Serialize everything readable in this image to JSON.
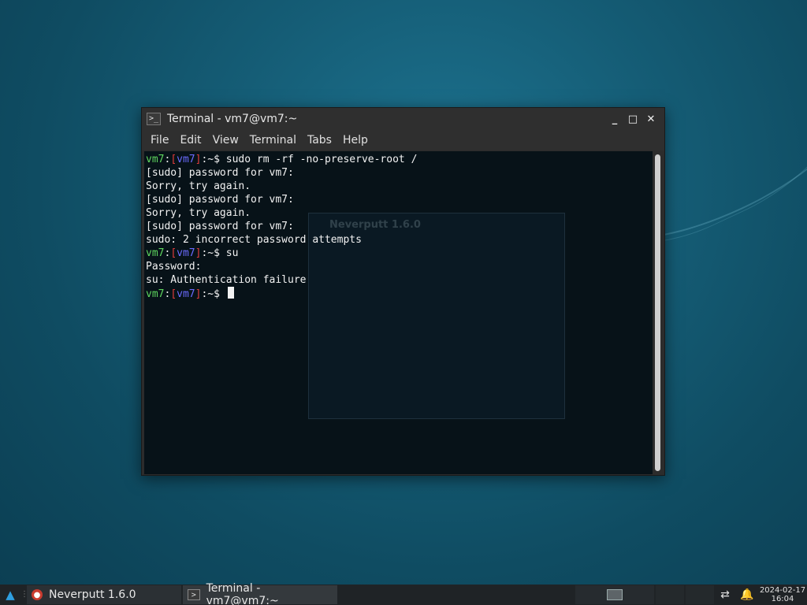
{
  "window": {
    "title": "Terminal - vm7@vm7:~",
    "icon": "terminal-icon",
    "controls": {
      "minimize": "_",
      "maximize": "□",
      "close": "✕"
    },
    "menu": [
      "File",
      "Edit",
      "View",
      "Terminal",
      "Tabs",
      "Help"
    ]
  },
  "terminal": {
    "prompt": {
      "user": "vm7",
      "host": "vm7",
      "path": "~",
      "symbol": "$"
    },
    "lines": [
      {
        "type": "prompt",
        "cmd": "sudo rm -rf -no-preserve-root /"
      },
      {
        "type": "out",
        "text": "[sudo] password for vm7:"
      },
      {
        "type": "out",
        "text": "Sorry, try again."
      },
      {
        "type": "out",
        "text": "[sudo] password for vm7:"
      },
      {
        "type": "out",
        "text": "Sorry, try again."
      },
      {
        "type": "out",
        "text": "[sudo] password for vm7:"
      },
      {
        "type": "out",
        "text": "sudo: 2 incorrect password attempts"
      },
      {
        "type": "prompt",
        "cmd": "su"
      },
      {
        "type": "out",
        "text": "Password:"
      },
      {
        "type": "out",
        "text": "su: Authentication failure"
      },
      {
        "type": "prompt",
        "cmd": "",
        "cursor": true
      }
    ],
    "background_window_title": "Neverputt 1.6.0"
  },
  "taskbar": {
    "tasks": [
      {
        "label": "Neverputt 1.6.0",
        "icon": "neverputt-icon",
        "active": false
      },
      {
        "label": "Terminal - vm7@vm7:~",
        "icon": "terminal-icon",
        "active": true
      }
    ],
    "clock": {
      "date": "2024-02-17",
      "time": "16:04"
    }
  },
  "colors": {
    "prompt_user": "#5fd75f",
    "prompt_bracket": "#e03c3c",
    "prompt_host": "#6b6bff"
  }
}
